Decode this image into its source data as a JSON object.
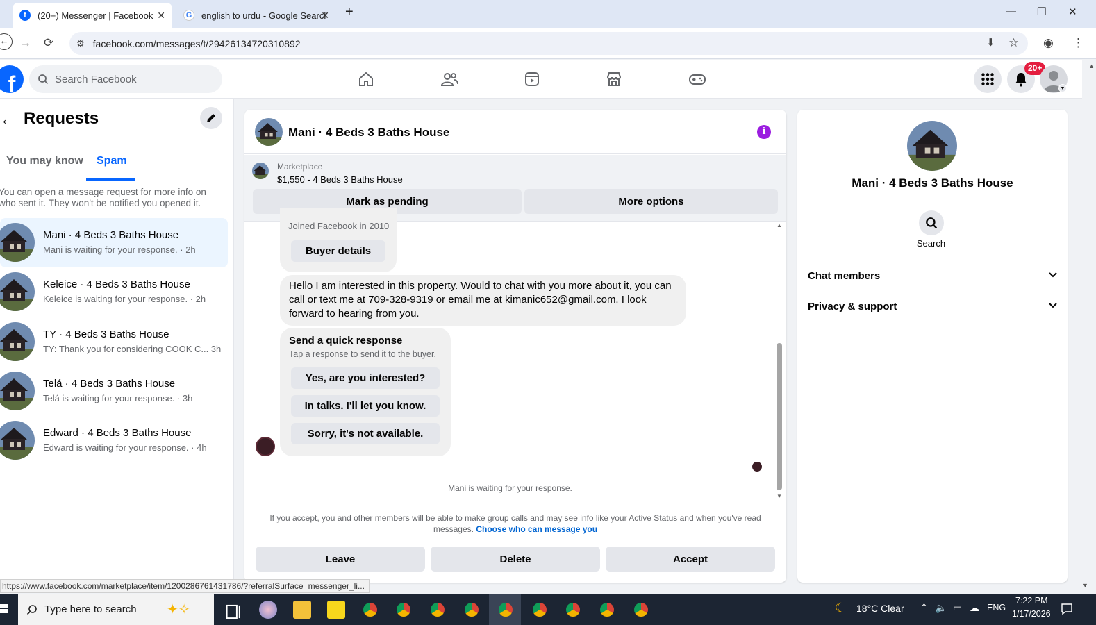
{
  "browser": {
    "tabs": [
      {
        "title": "(20+) Messenger | Facebook",
        "active": true
      },
      {
        "title": "english to urdu - Google Search",
        "active": false
      }
    ],
    "url": "facebook.com/messages/t/29426134720310892"
  },
  "fb": {
    "search_placeholder": "Search Facebook",
    "notif_badge": "20+",
    "brand_color": "#0866ff"
  },
  "requests": {
    "title": "Requests",
    "tabs": [
      "You may know",
      "Spam"
    ],
    "active_tab": "Spam",
    "info": "You can open a message request for more info on who sent it. They won't be notified you opened it.",
    "conversations": [
      {
        "name": "Mani · 4 Beds 3 Baths House",
        "preview": "Mani is waiting for your response. · 2h",
        "selected": true
      },
      {
        "name": "Keleice · 4 Beds 3 Baths House",
        "preview": "Keleice is waiting for your response. · 2h",
        "selected": false
      },
      {
        "name": "TY · 4 Beds 3 Baths House",
        "preview": "TY: Thank you for considering COOK C... 3h",
        "selected": false
      },
      {
        "name": "Telá · 4 Beds 3 Baths House",
        "preview": "Telá is waiting for your response. · 3h",
        "selected": false
      },
      {
        "name": "Edward · 4 Beds 3 Baths House",
        "preview": "Edward is waiting for your response. · 4h",
        "selected": false
      }
    ]
  },
  "chat": {
    "title": "Mani · 4 Beds 3 Baths House",
    "marketplace_label": "Marketplace",
    "listing": "$1,550 - 4 Beds 3 Baths House",
    "mark_pending": "Mark as pending",
    "more_options": "More options",
    "joined": "Joined Facebook in 2010",
    "buyer_details": "Buyer details",
    "message": "Hello I am interested in this property. Would to chat with you more about it, you can call or text me at 709-328-9319 or email me at kimanic652@gmail.com. I look forward to hearing from you.",
    "quick_title": "Send a quick response",
    "quick_sub": "Tap a response to send it to the buyer.",
    "quick_replies": [
      "Yes, are you interested?",
      "In talks. I'll let you know.",
      "Sorry, it's not available."
    ],
    "waiting": "Mani is waiting for your response.",
    "footnote": "If you accept, you and other members will be able to make group calls and may see info like your Active Status and when you've read messages.",
    "footnote_link": "Choose who can message you",
    "actions": [
      "Leave",
      "Delete",
      "Accept"
    ]
  },
  "info_panel": {
    "name": "Mani · 4 Beds 3 Baths House",
    "search_label": "Search",
    "sections": [
      "Chat members",
      "Privacy & support"
    ]
  },
  "status_link": "https://www.facebook.com/marketplace/item/1200286761431786/?referralSurface=messenger_li...",
  "taskbar": {
    "search_placeholder": "Type here to search",
    "weather": "18°C  Clear",
    "lang": "ENG",
    "time": "7:22 PM",
    "date": "1/17/2026"
  }
}
